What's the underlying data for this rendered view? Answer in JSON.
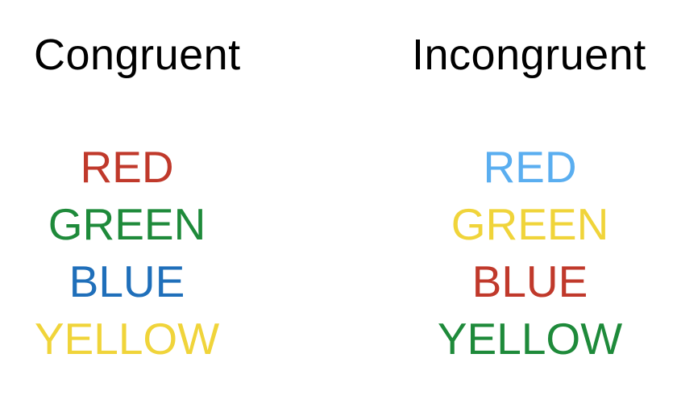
{
  "congruent": {
    "title": "Congruent",
    "words": [
      {
        "text": "RED",
        "color": "#c0392b"
      },
      {
        "text": "GREEN",
        "color": "#1e8a3a"
      },
      {
        "text": "BLUE",
        "color": "#1f6fba"
      },
      {
        "text": "YELLOW",
        "color": "#f0d43a"
      }
    ]
  },
  "incongruent": {
    "title": "Incongruent",
    "words": [
      {
        "text": "RED",
        "color": "#5aaef0"
      },
      {
        "text": "GREEN",
        "color": "#f0d43a"
      },
      {
        "text": "BLUE",
        "color": "#c0392b"
      },
      {
        "text": "YELLOW",
        "color": "#1e8a3a"
      }
    ]
  }
}
